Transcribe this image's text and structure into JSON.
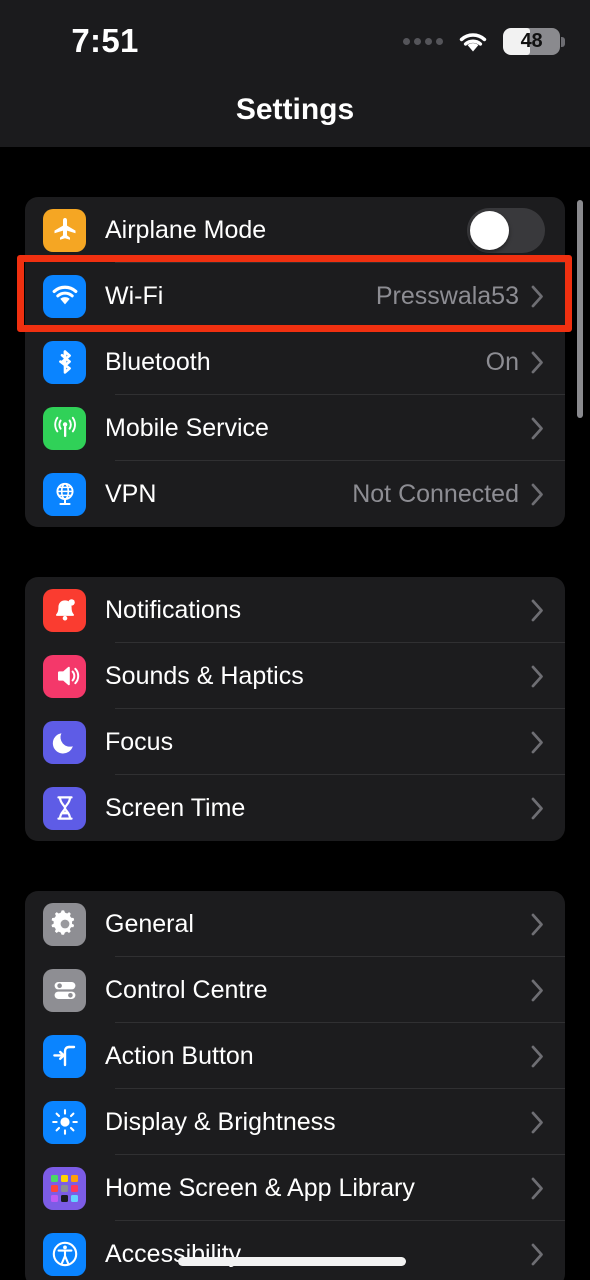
{
  "status_bar": {
    "time": "7:51",
    "cellular_icon": "cellular-dots-icon",
    "wifi_icon": "wifi-icon",
    "battery_level": "48",
    "battery_percent": 48,
    "battery_icon": "battery-icon"
  },
  "nav": {
    "title": "Settings"
  },
  "annotation": {
    "color": "#f03010",
    "target": "wifi-row"
  },
  "groups": [
    {
      "id": "connectivity",
      "rows": [
        {
          "label": "Airplane Mode",
          "value": "",
          "icon": "airplane-icon",
          "icon_color": "#f5a623",
          "accessory": "toggle",
          "toggle_on": false
        },
        {
          "label": "Wi-Fi",
          "value": "Presswala53",
          "icon": "wifi-icon",
          "icon_color": "#0a84ff",
          "accessory": "chevron",
          "highlighted": true
        },
        {
          "label": "Bluetooth",
          "value": "On",
          "icon": "bluetooth-icon",
          "icon_color": "#0a84ff",
          "accessory": "chevron"
        },
        {
          "label": "Mobile Service",
          "value": "",
          "icon": "cellular-antenna-icon",
          "icon_color": "#30d158",
          "accessory": "chevron"
        },
        {
          "label": "VPN",
          "value": "Not Connected",
          "icon": "vpn-globe-icon",
          "icon_color": "#0a84ff",
          "accessory": "chevron"
        }
      ]
    },
    {
      "id": "alerts",
      "rows": [
        {
          "label": "Notifications",
          "value": "",
          "icon": "bell-icon",
          "icon_color": "#fa3c30",
          "accessory": "chevron"
        },
        {
          "label": "Sounds & Haptics",
          "value": "",
          "icon": "speaker-icon",
          "icon_color": "#f4386a",
          "accessory": "chevron"
        },
        {
          "label": "Focus",
          "value": "",
          "icon": "moon-icon",
          "icon_color": "#5e5ce6",
          "accessory": "chevron"
        },
        {
          "label": "Screen Time",
          "value": "",
          "icon": "hourglass-icon",
          "icon_color": "#5e5ce6",
          "accessory": "chevron"
        }
      ]
    },
    {
      "id": "system",
      "rows": [
        {
          "label": "General",
          "value": "",
          "icon": "gear-icon",
          "icon_color": "#8e8e93",
          "accessory": "chevron"
        },
        {
          "label": "Control Centre",
          "value": "",
          "icon": "sliders-icon",
          "icon_color": "#8e8e93",
          "accessory": "chevron"
        },
        {
          "label": "Action Button",
          "value": "",
          "icon": "action-button-icon",
          "icon_color": "#0a84ff",
          "accessory": "chevron"
        },
        {
          "label": "Display & Brightness",
          "value": "",
          "icon": "brightness-sun-icon",
          "icon_color": "#0a84ff",
          "accessory": "chevron"
        },
        {
          "label": "Home Screen & App Library",
          "value": "",
          "icon": "app-grid-icon",
          "icon_color": "#7c5ce6",
          "accessory": "chevron"
        },
        {
          "label": "Accessibility",
          "value": "",
          "icon": "accessibility-icon",
          "icon_color": "#0a84ff",
          "accessory": "chevron"
        }
      ]
    }
  ]
}
